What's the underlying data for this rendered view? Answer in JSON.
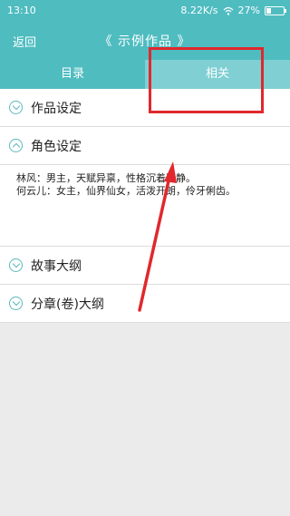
{
  "status_bar": {
    "time": "13:10",
    "signal_icon": "signal-icon",
    "speed": "8.22K/s",
    "wifi_icon": "wifi-icon",
    "battery_percent": "27%",
    "battery_level": 0.27
  },
  "app_bar": {
    "back_label": "返回",
    "title": "《 示例作品 》"
  },
  "tabs": [
    {
      "label": "目录",
      "active": false
    },
    {
      "label": "相关",
      "active": true
    }
  ],
  "sections": [
    {
      "title": "作品设定",
      "expanded": false
    },
    {
      "title": "角色设定",
      "expanded": true,
      "lines": [
        "林风：男主，天赋异禀，性格沉着冷静。",
        "何云儿：女主，仙界仙女，活泼开朗，伶牙俐齿。"
      ]
    },
    {
      "title": "故事大纲",
      "expanded": false
    },
    {
      "title": "分章(卷)大纲",
      "expanded": false
    }
  ],
  "colors": {
    "accent": "#4fbcc0",
    "active_tab": "#7fcfd3",
    "annotation": "#e0282d",
    "background": "#ebebeb"
  }
}
